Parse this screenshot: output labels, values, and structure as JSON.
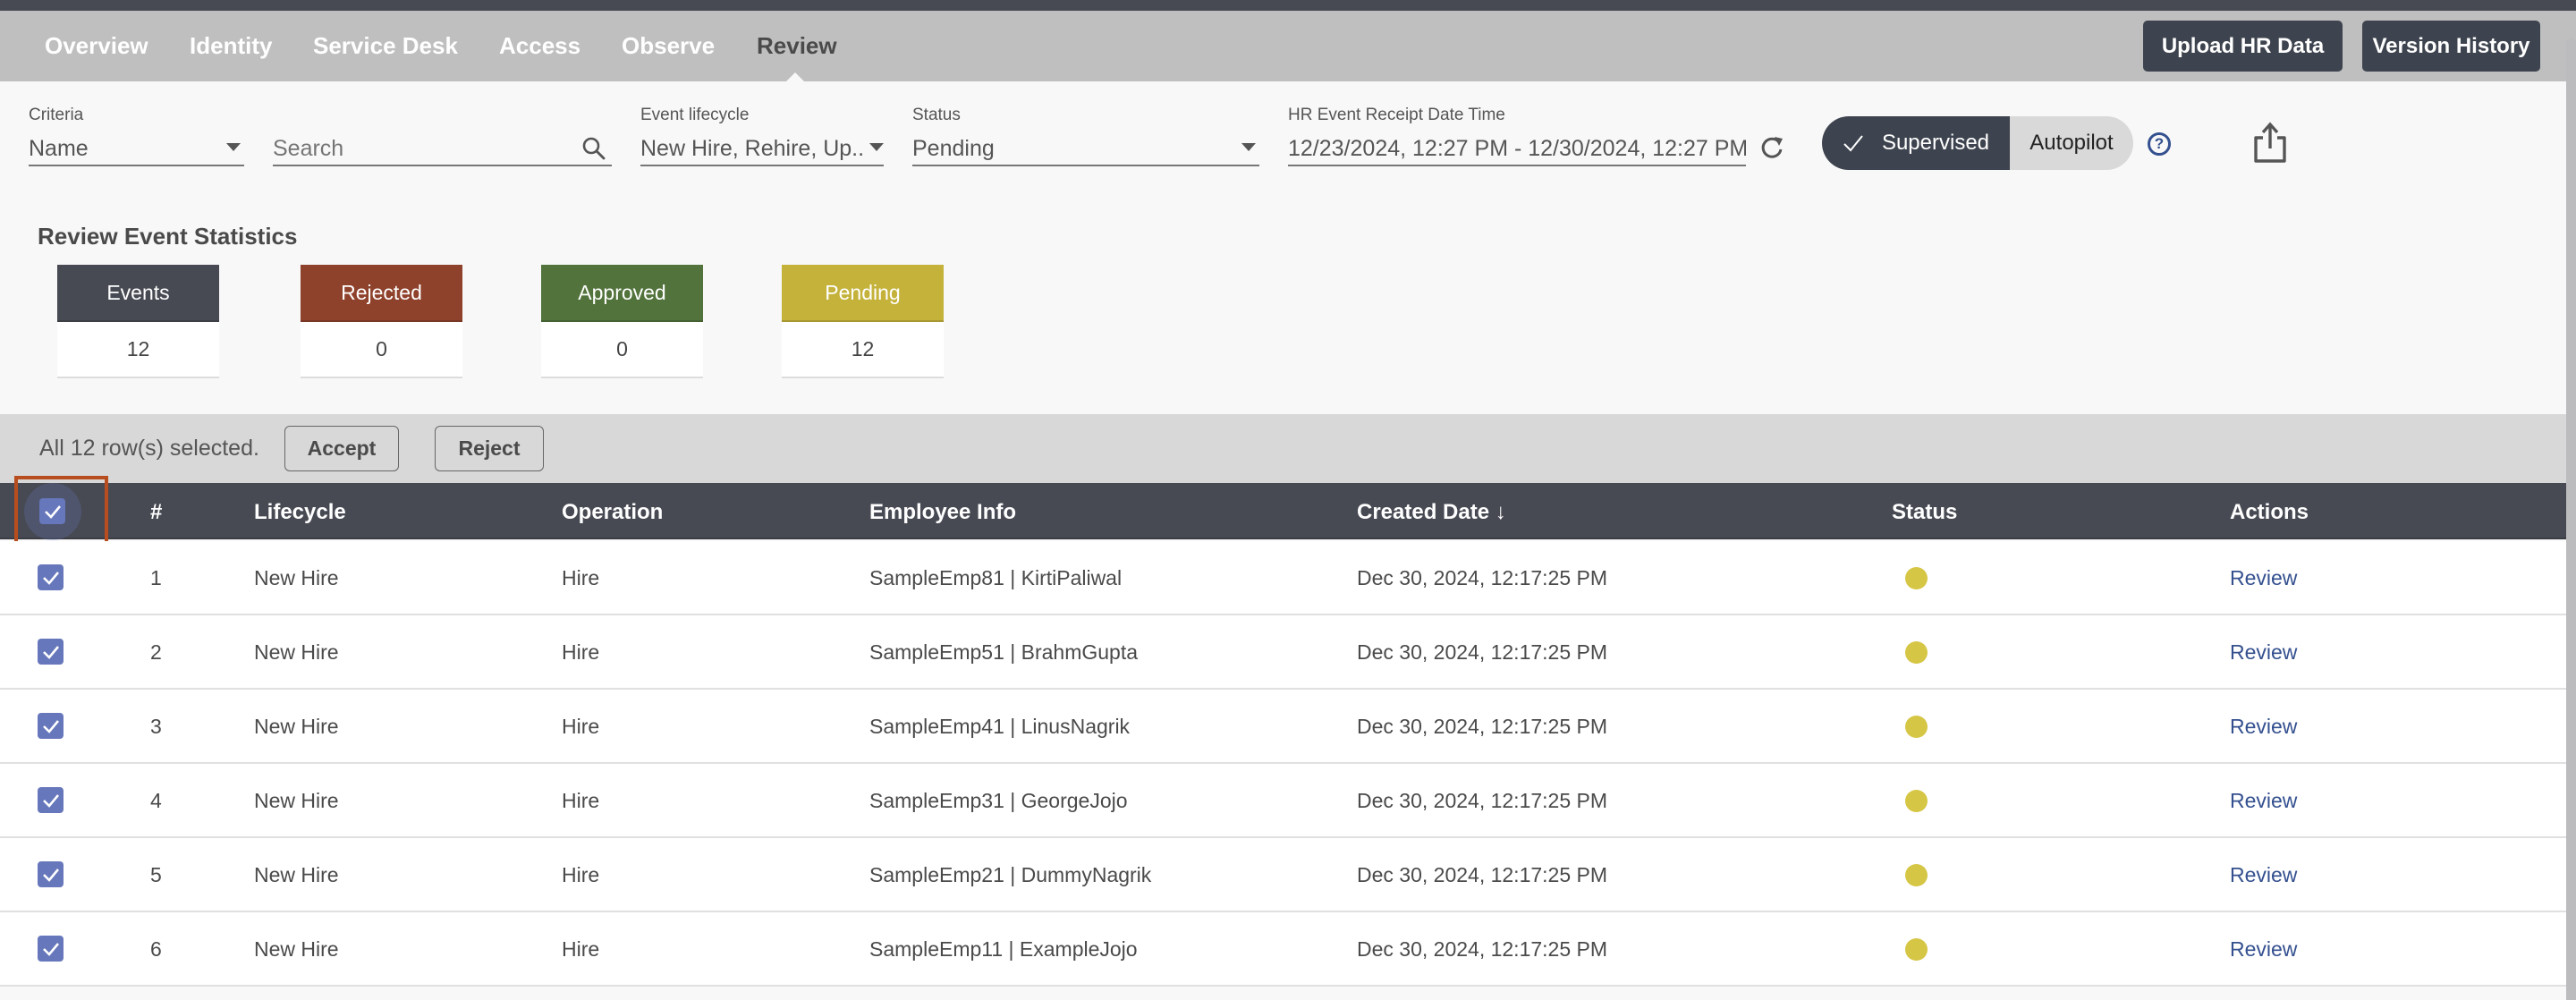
{
  "nav": {
    "tabs": [
      {
        "label": "Overview",
        "active": false
      },
      {
        "label": "Identity",
        "active": false
      },
      {
        "label": "Service Desk",
        "active": false
      },
      {
        "label": "Access",
        "active": false
      },
      {
        "label": "Observe",
        "active": false
      },
      {
        "label": "Review",
        "active": true
      }
    ],
    "upload_label": "Upload HR Data",
    "version_history_label": "Version History"
  },
  "filters": {
    "criteria": {
      "label": "Criteria",
      "value": "Name"
    },
    "search": {
      "placeholder": "Search",
      "value": ""
    },
    "lifecycle": {
      "label": "Event lifecycle",
      "value": "New Hire, Rehire, Up..."
    },
    "status": {
      "label": "Status",
      "value": "Pending"
    },
    "date_range": {
      "label": "HR Event Receipt Date Time",
      "value": "12/23/2024, 12:27 PM - 12/30/2024, 12:27 PM"
    }
  },
  "mode_toggle": {
    "supervised_label": "Supervised",
    "autopilot_label": "Autopilot",
    "selected": "Supervised",
    "help_glyph": "?"
  },
  "stats": {
    "title": "Review Event Statistics",
    "cards": [
      {
        "label": "Events",
        "value": "12",
        "color": "#474a53"
      },
      {
        "label": "Rejected",
        "value": "0",
        "color": "#8e412b"
      },
      {
        "label": "Approved",
        "value": "0",
        "color": "#52733b"
      },
      {
        "label": "Pending",
        "value": "12",
        "color": "#c4b23b"
      }
    ]
  },
  "selection": {
    "text": "All 12 row(s) selected.",
    "accept_label": "Accept",
    "reject_label": "Reject"
  },
  "table": {
    "columns": {
      "num": "#",
      "lifecycle": "Lifecycle",
      "operation": "Operation",
      "employee": "Employee Info",
      "created": "Created Date ↓",
      "status": "Status",
      "actions": "Actions"
    },
    "header_checked": true,
    "rows": [
      {
        "num": "1",
        "lifecycle": "New Hire",
        "operation": "Hire",
        "employee": "SampleEmp81 | KirtiPaliwal",
        "created": "Dec 30, 2024, 12:17:25 PM",
        "status": "Pending",
        "action": "Review",
        "checked": true
      },
      {
        "num": "2",
        "lifecycle": "New Hire",
        "operation": "Hire",
        "employee": "SampleEmp51 | BrahmGupta",
        "created": "Dec 30, 2024, 12:17:25 PM",
        "status": "Pending",
        "action": "Review",
        "checked": true
      },
      {
        "num": "3",
        "lifecycle": "New Hire",
        "operation": "Hire",
        "employee": "SampleEmp41 | LinusNagrik",
        "created": "Dec 30, 2024, 12:17:25 PM",
        "status": "Pending",
        "action": "Review",
        "checked": true
      },
      {
        "num": "4",
        "lifecycle": "New Hire",
        "operation": "Hire",
        "employee": "SampleEmp31 | GeorgeJojo",
        "created": "Dec 30, 2024, 12:17:25 PM",
        "status": "Pending",
        "action": "Review",
        "checked": true
      },
      {
        "num": "5",
        "lifecycle": "New Hire",
        "operation": "Hire",
        "employee": "SampleEmp21 | DummyNagrik",
        "created": "Dec 30, 2024, 12:17:25 PM",
        "status": "Pending",
        "action": "Review",
        "checked": true
      },
      {
        "num": "6",
        "lifecycle": "New Hire",
        "operation": "Hire",
        "employee": "SampleEmp11 | ExampleJojo",
        "created": "Dec 30, 2024, 12:17:25 PM",
        "status": "Pending",
        "action": "Review",
        "checked": true
      }
    ],
    "status_color": "#d6c645"
  }
}
